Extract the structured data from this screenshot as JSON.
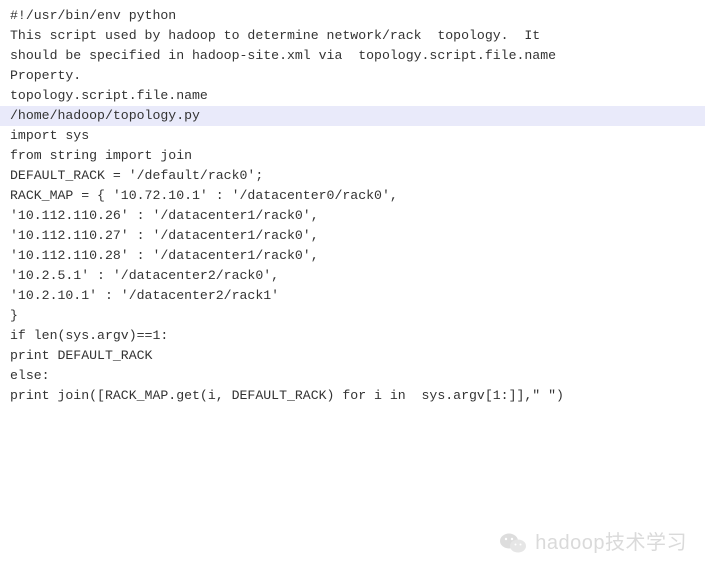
{
  "lines": {
    "l0": "#!/usr/bin/env python",
    "l1": "",
    "l2": "This script used by hadoop to determine network/rack  topology.  It",
    "l3": "should be specified in hadoop-site.xml via  topology.script.file.name",
    "l4": "Property.",
    "l5": "",
    "l6": "topology.script.file.name",
    "l7": "/home/hadoop/topology.py",
    "l8": "",
    "l9": "",
    "l10": "import sys",
    "l11": "from string import join",
    "l12": "",
    "l13": "DEFAULT_RACK = '/default/rack0';",
    "l14": "",
    "l15": "RACK_MAP = { '10.72.10.1' : '/datacenter0/rack0',",
    "l16": "'10.112.110.26' : '/datacenter1/rack0',",
    "l17": "'10.112.110.27' : '/datacenter1/rack0',",
    "l18": "'10.112.110.28' : '/datacenter1/rack0',",
    "l19": "'10.2.5.1' : '/datacenter2/rack0',",
    "l20": "'10.2.10.1' : '/datacenter2/rack1'",
    "l21": "}",
    "l22": "",
    "l23": "if len(sys.argv)==1:",
    "l24": "print DEFAULT_RACK",
    "l25": "else:",
    "l26": "print join([RACK_MAP.get(i, DEFAULT_RACK) for i in  sys.argv[1:]],\" \")"
  },
  "watermark": "hadoop技术学习"
}
